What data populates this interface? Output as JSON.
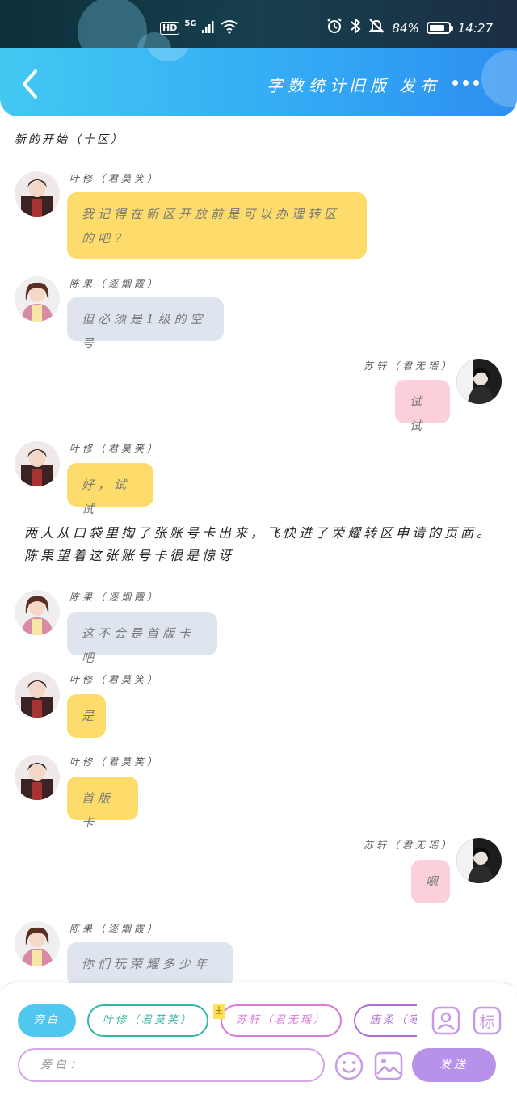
{
  "status_bar": {
    "hd": "HD",
    "network": "5G",
    "battery_text": "84%",
    "battery_level": 0.84,
    "time": "14:27"
  },
  "header": {
    "actions": [
      "字数统计",
      "旧版",
      "发布"
    ]
  },
  "chapter_title": "新的开始（十区）",
  "messages": [
    {
      "name": "叶修（君莫笑）",
      "text": "我记得在新区开放前是可以办理转区的吧？"
    },
    {
      "name": "陈果（逐烟霞）",
      "text": "但必须是1级的空号"
    },
    {
      "name": "苏轩（君无瑶）",
      "text": "试试"
    },
    {
      "name": "叶修（君莫笑）",
      "text": "好，试试"
    },
    {
      "name": "陈果（逐烟霞）",
      "text": "这不会是首版卡吧"
    },
    {
      "name": "叶修（君莫笑）",
      "text": "是"
    },
    {
      "name": "叶修（君莫笑）",
      "text": "首版卡"
    },
    {
      "name": "苏轩（君无瑶）",
      "text": "嗯"
    },
    {
      "name": "陈果（逐烟霞）",
      "text": "你们玩荣耀多少年了"
    }
  ],
  "narration": "两人从口袋里掏了张账号卡出来，飞快进了荣耀转区申请的页面。陈果望着这张账号卡很是惊讶",
  "composer": {
    "chips": [
      "旁白",
      "叶修（君莫笑）",
      "苏轩（君无瑶）",
      "唐柔（寒"
    ],
    "tag": "主",
    "role_icon": "标",
    "input_placeholder": "旁白：",
    "send_label": "发送"
  },
  "colors": {
    "header_start": "#43c8f2",
    "header_end": "#2d8ff0",
    "bubble_yexiu": "#fddc6b",
    "bubble_chenguo": "#dfe5ee",
    "bubble_suxuan": "#fcd0da",
    "send_button": "#b892ea"
  }
}
